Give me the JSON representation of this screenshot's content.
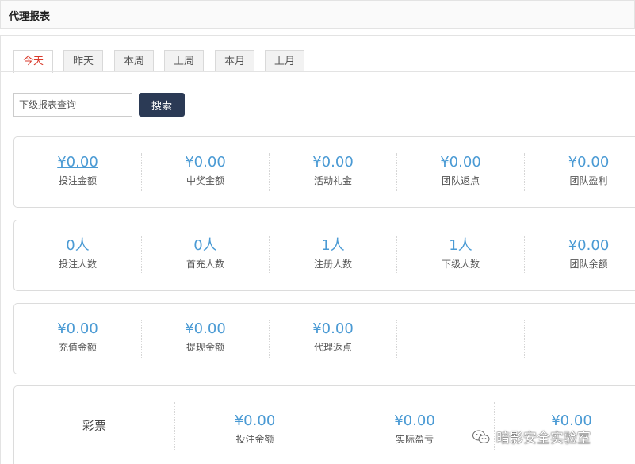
{
  "header": {
    "title": "代理报表"
  },
  "tabs": [
    "今天",
    "昨天",
    "本周",
    "上周",
    "本月",
    "上月"
  ],
  "search": {
    "placeholder": "下级报表查询",
    "button_label": "搜索"
  },
  "row1": [
    {
      "value": "¥0.00",
      "label": "投注金额"
    },
    {
      "value": "¥0.00",
      "label": "中奖金额"
    },
    {
      "value": "¥0.00",
      "label": "活动礼金"
    },
    {
      "value": "¥0.00",
      "label": "团队返点"
    },
    {
      "value": "¥0.00",
      "label": "团队盈利"
    }
  ],
  "row2": [
    {
      "value": "0人",
      "label": "投注人数"
    },
    {
      "value": "0人",
      "label": "首充人数"
    },
    {
      "value": "1人",
      "label": "注册人数"
    },
    {
      "value": "1人",
      "label": "下级人数"
    },
    {
      "value": "¥0.00",
      "label": "团队余额"
    }
  ],
  "row3": [
    {
      "value": "¥0.00",
      "label": "充值金额"
    },
    {
      "value": "¥0.00",
      "label": "提现金额"
    },
    {
      "value": "¥0.00",
      "label": "代理返点"
    }
  ],
  "row4": {
    "category": "彩票",
    "items": [
      {
        "value": "¥0.00",
        "label": "投注金额"
      },
      {
        "value": "¥0.00",
        "label": "实际盈亏"
      },
      {
        "value": "¥0.00",
        "label": ""
      }
    ]
  },
  "watermark": "暗影安全实验室",
  "colors": {
    "accent": "#4a9ad4",
    "active_tab": "#d93a2b",
    "button_bg": "#2b3a55"
  }
}
